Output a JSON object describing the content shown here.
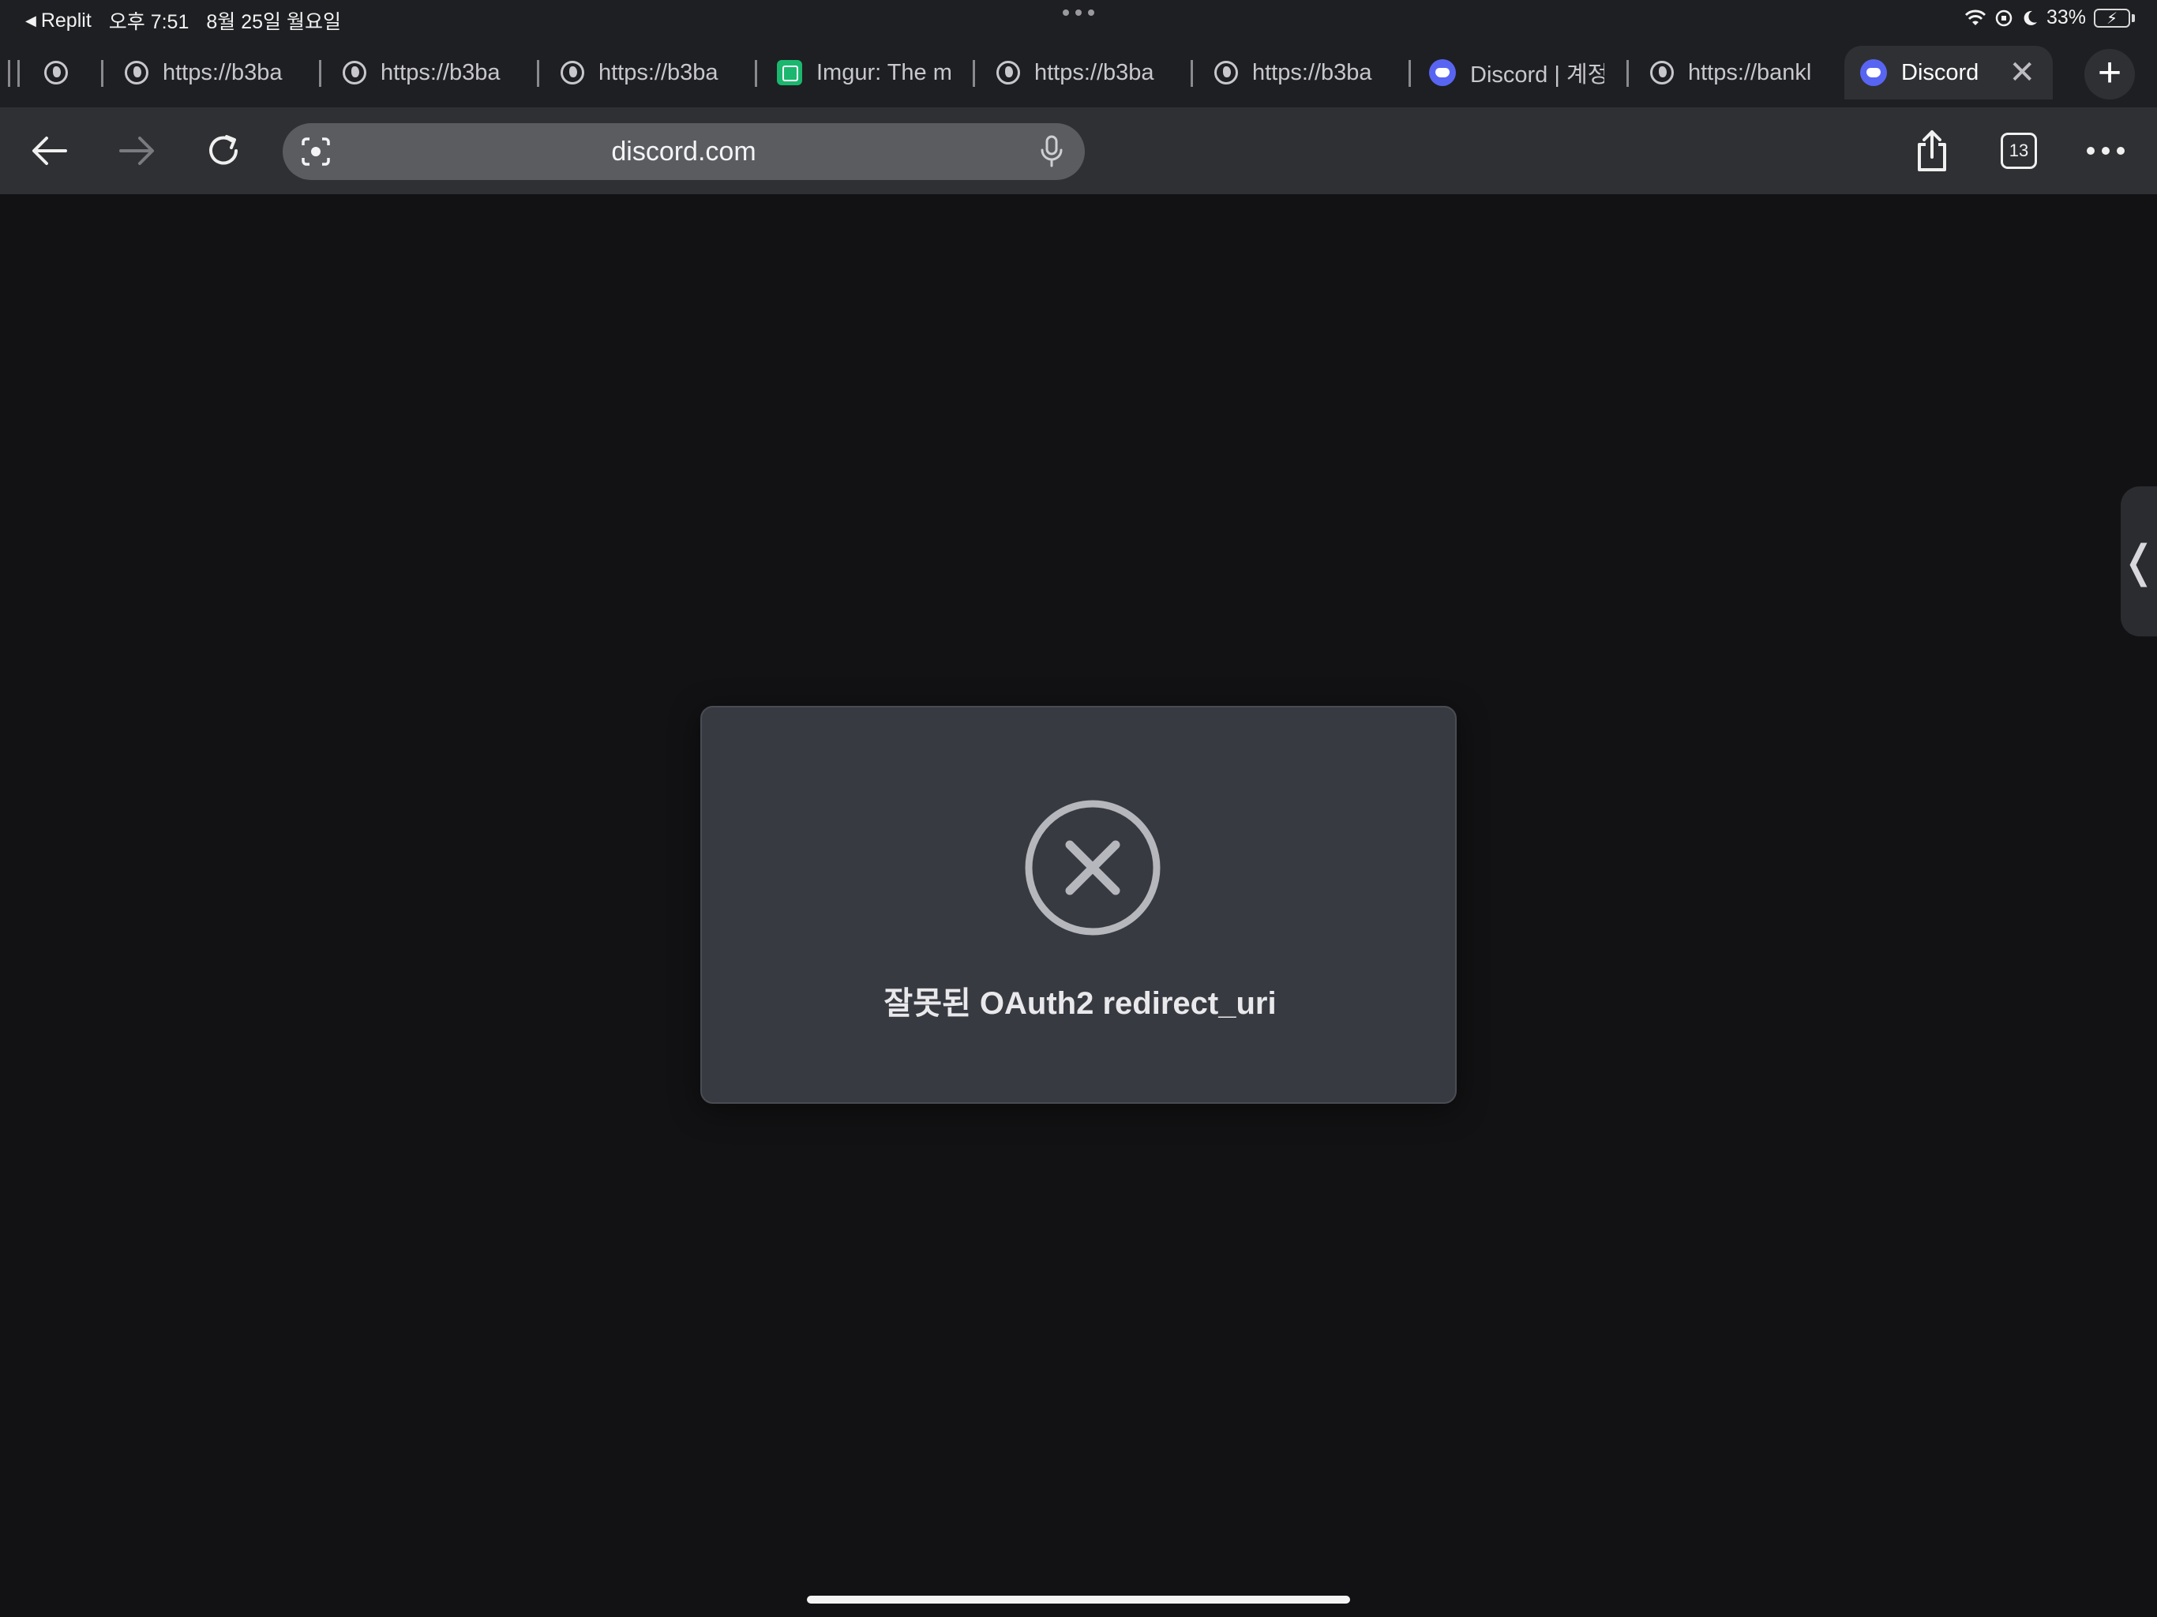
{
  "status_bar": {
    "back_app": "Replit",
    "time": "오후 7:51",
    "date": "8월 25일 월요일",
    "battery": "33%",
    "battery_level_percent": 33
  },
  "tabs": [
    {
      "label": "",
      "icon": "globe-icon"
    },
    {
      "label": "https://b3ba",
      "icon": "globe-icon"
    },
    {
      "label": "https://b3ba",
      "icon": "globe-icon"
    },
    {
      "label": "https://b3ba",
      "icon": "globe-icon"
    },
    {
      "label": "Imgur: The m",
      "icon": "imgur-icon"
    },
    {
      "label": "https://b3ba",
      "icon": "globe-icon"
    },
    {
      "label": "https://b3ba",
      "icon": "globe-icon"
    },
    {
      "label": "Discord | 계정",
      "icon": "discord-icon"
    },
    {
      "label": "https://bankl",
      "icon": "globe-icon"
    },
    {
      "label": "Discord |",
      "icon": "discord-icon",
      "active": true
    }
  ],
  "toolbar": {
    "url": "discord.com",
    "tab_count": "13"
  },
  "error_card": {
    "message": "잘못된 OAuth2 redirect_uri"
  },
  "colors": {
    "page_bg": "#121214",
    "card_bg": "#383a42",
    "icon_gray": "#b5b7bd",
    "discord_blurple": "#5865f2"
  }
}
